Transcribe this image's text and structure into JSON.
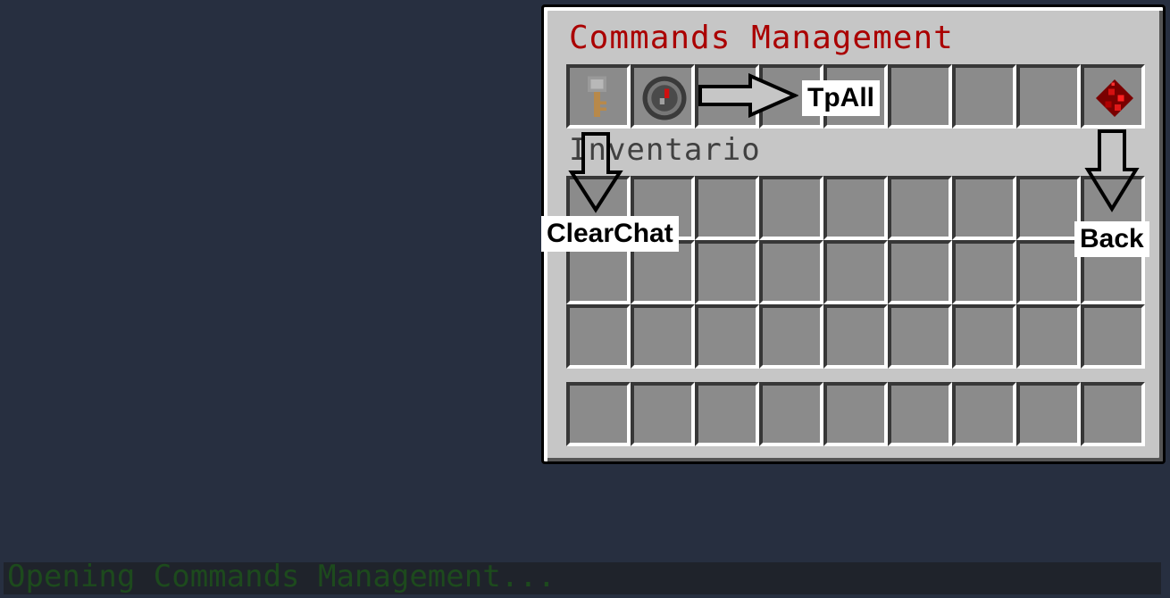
{
  "gui": {
    "title": "Commands Management",
    "inventory_label": "Inventario",
    "title_color": "#aa0000"
  },
  "top_row_items": [
    {
      "icon": "key-icon",
      "tooltip": "ClearChat"
    },
    {
      "icon": "compass-icon",
      "tooltip": "TpAll"
    },
    {
      "icon": "",
      "tooltip": ""
    },
    {
      "icon": "",
      "tooltip": ""
    },
    {
      "icon": "",
      "tooltip": ""
    },
    {
      "icon": "",
      "tooltip": ""
    },
    {
      "icon": "",
      "tooltip": ""
    },
    {
      "icon": "",
      "tooltip": ""
    },
    {
      "icon": "redstone-dust-icon",
      "tooltip": "Back"
    }
  ],
  "annotations": {
    "tpall": "TpAll",
    "clearchat": "ClearChat",
    "back": "Back"
  },
  "chat": {
    "message": "Opening Commands Management...",
    "color": "#1d4a1d"
  }
}
